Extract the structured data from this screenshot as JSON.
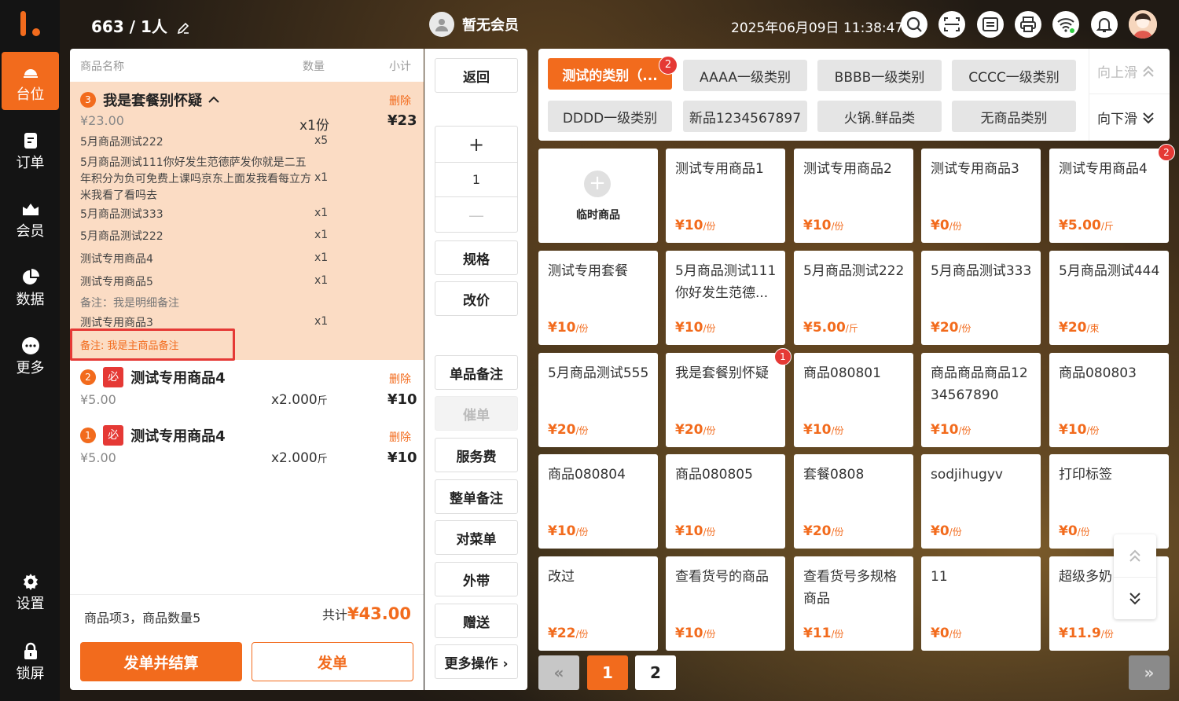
{
  "sidebar": {
    "items": [
      {
        "label": "台位",
        "icon": "table-service-icon",
        "active": true
      },
      {
        "label": "订单",
        "icon": "order-icon",
        "active": false
      },
      {
        "label": "会员",
        "icon": "member-icon",
        "active": false
      },
      {
        "label": "数据",
        "icon": "pie-chart-icon",
        "active": false
      },
      {
        "label": "更多",
        "icon": "more-icon",
        "active": false
      },
      {
        "label": "设置",
        "icon": "gear-icon",
        "active": false
      },
      {
        "label": "锁屏",
        "icon": "lock-icon",
        "active": false
      }
    ]
  },
  "header": {
    "table_no": "663",
    "people": "/ 1人",
    "member": "暂无会员",
    "datetime": "2025年06月09日 11:38:47",
    "icons": [
      "search-icon",
      "scan-icon",
      "list-icon",
      "printer-icon",
      "wifi-icon",
      "bell-icon",
      "user-avatar"
    ]
  },
  "order": {
    "columns": {
      "name": "商品名称",
      "qty": "数量",
      "subtotal": "小计"
    },
    "combo": {
      "index": "3",
      "name": "我是套餐别怀疑",
      "delete": "删除",
      "unit_price": "¥23.00",
      "qty": "x1份",
      "subtotal": "¥23",
      "items": [
        {
          "name": "5月商品测试222",
          "qty": "x5"
        },
        {
          "name": "5月商品测试111你好发生范德萨发你就是二五年积分为负可免费上课吗京东上面发我看每立方米我看了看吗去",
          "qty": "x1"
        },
        {
          "name": "5月商品测试333",
          "qty": "x1"
        },
        {
          "name": "5月商品测试222",
          "qty": "x1"
        },
        {
          "name": "测试专用商品4",
          "qty": "x1"
        },
        {
          "name": "测试专用商品5",
          "qty": "x1"
        },
        {
          "name": "备注：我是明细备注",
          "qty": ""
        },
        {
          "name": "测试专用商品3",
          "qty": "x1"
        }
      ],
      "main_remark": "备注: 我是主商品备注"
    },
    "lines": [
      {
        "index": "2",
        "tag": "必",
        "name": "测试专用商品4",
        "delete": "删除",
        "unit_price": "¥5.00",
        "qty": "x2.000",
        "unit": "斤",
        "subtotal": "¥10"
      },
      {
        "index": "1",
        "tag": "必",
        "name": "测试专用商品4",
        "delete": "删除",
        "unit_price": "¥5.00",
        "qty": "x2.000",
        "unit": "斤",
        "subtotal": "¥10"
      }
    ],
    "summary": "商品项3，商品数量5",
    "total_label": "共计",
    "total": "¥43.00",
    "btn_checkout": "发单并结算",
    "btn_send": "发单"
  },
  "actions": {
    "back": "返回",
    "plus": "+",
    "qty": "1",
    "minus": "—",
    "spec": "规格",
    "price": "改价",
    "item_note": "单品备注",
    "urge": "催单",
    "service_fee": "服务费",
    "order_note": "整单备注",
    "check_menu": "对菜单",
    "takeaway": "外带",
    "gift": "赠送",
    "more": "更多操作 ›"
  },
  "categories": {
    "items": [
      {
        "label": "测试的类别（...",
        "active": true,
        "badge": "2"
      },
      {
        "label": "AAAA一级类别",
        "active": false
      },
      {
        "label": "BBBB一级类别",
        "active": false
      },
      {
        "label": "CCCC一级类别",
        "active": false
      },
      {
        "label": "DDDD一级类别",
        "active": false
      },
      {
        "label": "新品1234567897",
        "active": false
      },
      {
        "label": "火锅.鲜品类",
        "active": false
      },
      {
        "label": "无商品类别",
        "active": false
      }
    ],
    "scroll_up": "向上滑",
    "scroll_down": "向下滑"
  },
  "products": {
    "temp_label": "临时商品",
    "items": [
      {
        "name": "测试专用商品1",
        "price": "¥10",
        "unit": "/份"
      },
      {
        "name": "测试专用商品2",
        "price": "¥10",
        "unit": "/份"
      },
      {
        "name": "测试专用商品3",
        "price": "¥0",
        "unit": "/份"
      },
      {
        "name": "测试专用商品4",
        "price": "¥5.00",
        "unit": "/斤",
        "badge": "2"
      },
      {
        "name": "测试专用套餐",
        "price": "¥10",
        "unit": "/份"
      },
      {
        "name": "5月商品测试111你好发生范德...",
        "price": "¥10",
        "unit": "/份"
      },
      {
        "name": "5月商品测试222",
        "price": "¥5.00",
        "unit": "/斤"
      },
      {
        "name": "5月商品测试333",
        "price": "¥20",
        "unit": "/份"
      },
      {
        "name": "5月商品测试444",
        "price": "¥20",
        "unit": "/束"
      },
      {
        "name": "5月商品测试555",
        "price": "¥20",
        "unit": "/份"
      },
      {
        "name": "我是套餐别怀疑",
        "price": "¥20",
        "unit": "/份",
        "badge": "1"
      },
      {
        "name": "商品080801",
        "price": "¥10",
        "unit": "/份"
      },
      {
        "name": "商品商品商品1234567890",
        "price": "¥10",
        "unit": "/份"
      },
      {
        "name": "商品080803",
        "price": "¥10",
        "unit": "/份"
      },
      {
        "name": "商品080804",
        "price": "¥10",
        "unit": "/份"
      },
      {
        "name": "商品080805",
        "price": "¥10",
        "unit": "/份"
      },
      {
        "name": "套餐0808",
        "price": "¥20",
        "unit": "/份"
      },
      {
        "name": "sodjihugyv",
        "price": "¥0",
        "unit": "/份"
      },
      {
        "name": "打印标签",
        "price": "¥0",
        "unit": "/份"
      },
      {
        "name": "改过",
        "price": "¥22",
        "unit": "/份"
      },
      {
        "name": "查看货号的商品",
        "price": "¥10",
        "unit": "/份"
      },
      {
        "name": "查看货号多规格商品",
        "price": "¥11",
        "unit": "/份"
      },
      {
        "name": "11",
        "price": "¥0",
        "unit": "/份"
      },
      {
        "name": "超级多奶",
        "price": "¥11.9",
        "unit": "/份"
      }
    ]
  },
  "pagination": {
    "prev": "«",
    "pages": [
      "1",
      "2"
    ],
    "current": "1",
    "next": "»"
  }
}
